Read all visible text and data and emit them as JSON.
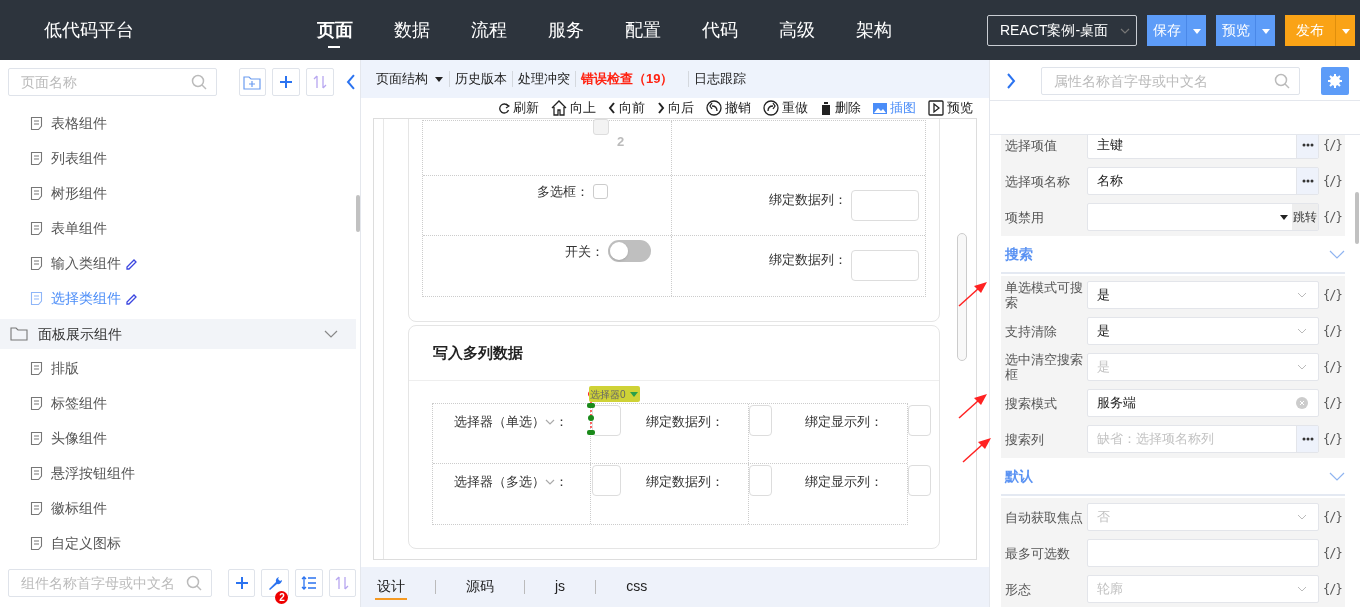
{
  "app_title": "低代码平台",
  "nav": [
    {
      "label": "页面",
      "selected": true
    },
    {
      "label": "数据",
      "selected": false
    },
    {
      "label": "流程",
      "selected": false
    },
    {
      "label": "服务",
      "selected": false
    },
    {
      "label": "配置",
      "selected": false
    },
    {
      "label": "代码",
      "selected": false
    },
    {
      "label": "高级",
      "selected": false
    },
    {
      "label": "架构",
      "selected": false
    }
  ],
  "project_select": "REACT案例-桌面",
  "actions": [
    {
      "label": "保存",
      "kind": "primary"
    },
    {
      "label": "预览",
      "kind": "primary"
    },
    {
      "label": "发布",
      "kind": "publish"
    }
  ],
  "left": {
    "search_placeholder": "页面名称",
    "tree": [
      {
        "kind": "page",
        "label": "表格组件",
        "selected": false,
        "edited": false
      },
      {
        "kind": "page",
        "label": "列表组件",
        "selected": false,
        "edited": false
      },
      {
        "kind": "page",
        "label": "树形组件",
        "selected": false,
        "edited": false
      },
      {
        "kind": "page",
        "label": "表单组件",
        "selected": false,
        "edited": false
      },
      {
        "kind": "page",
        "label": "输入类组件",
        "selected": false,
        "edited": true
      },
      {
        "kind": "page",
        "label": "选择类组件",
        "selected": true,
        "edited": true
      },
      {
        "kind": "folder",
        "label": "面板展示组件",
        "expanded": true,
        "children": [
          {
            "kind": "page",
            "label": "排版",
            "selected": false,
            "edited": false
          },
          {
            "kind": "page",
            "label": "标签组件",
            "selected": false,
            "edited": false
          },
          {
            "kind": "page",
            "label": "头像组件",
            "selected": false,
            "edited": false
          },
          {
            "kind": "page",
            "label": "悬浮按钮组件",
            "selected": false,
            "edited": false
          },
          {
            "kind": "page",
            "label": "徽标组件",
            "selected": false,
            "edited": false
          },
          {
            "kind": "page",
            "label": "自定义图标",
            "selected": false,
            "edited": false
          }
        ]
      }
    ],
    "bottom_search_placeholder": "组件名称首字母或中文名",
    "tool_badge": "2"
  },
  "editor": {
    "tabs": [
      {
        "label": "页面结构",
        "kind": "dropdown"
      },
      {
        "label": "历史版本",
        "kind": "plain"
      },
      {
        "label": "处理冲突",
        "kind": "plain"
      },
      {
        "label": "错误检查（19）",
        "kind": "error"
      },
      {
        "label": "日志跟踪",
        "kind": "plain"
      }
    ],
    "tools": [
      {
        "label": "刷新",
        "selected": false
      },
      {
        "label": "向上",
        "selected": false
      },
      {
        "label": "向前",
        "selected": false
      },
      {
        "label": "向后",
        "selected": false
      },
      {
        "label": "撤销",
        "selected": false
      },
      {
        "label": "重做",
        "selected": false
      },
      {
        "label": "删除",
        "selected": false
      },
      {
        "label": "插图",
        "selected": true
      },
      {
        "label": "预览",
        "selected": false
      }
    ],
    "top_form": {
      "rows": [
        {
          "cells": [
            {
              "kind": "option",
              "text": "2",
              "disabled": true
            },
            {
              "kind": "empty"
            }
          ]
        },
        {
          "cells": [
            {
              "kind": "checkbox",
              "label": "多选框：",
              "checked": false
            },
            {
              "kind": "input",
              "label": "绑定数据列："
            }
          ]
        },
        {
          "cells": [
            {
              "kind": "switch",
              "label": "开关：",
              "on": false
            },
            {
              "kind": "input",
              "label": "绑定数据列："
            }
          ]
        }
      ]
    },
    "section": {
      "title": "写入多列数据",
      "selection_tag": "选择器0",
      "rows": [
        {
          "cells": [
            {
              "kind": "select",
              "label": "选择器（单选）",
              "suffix": "：",
              "selected": true
            },
            {
              "kind": "input",
              "label": "绑定数据列："
            },
            {
              "kind": "input",
              "label": "绑定显示列："
            }
          ]
        },
        {
          "cells": [
            {
              "kind": "select",
              "label": "选择器（多选）",
              "suffix": "：",
              "selected": false
            },
            {
              "kind": "input",
              "label": "绑定数据列："
            },
            {
              "kind": "input",
              "label": "绑定显示列："
            }
          ]
        }
      ]
    },
    "bottom_tabs": [
      {
        "label": "设计",
        "selected": true
      },
      {
        "label": "源码",
        "selected": false
      },
      {
        "label": "js",
        "selected": false
      },
      {
        "label": "css",
        "selected": false
      }
    ]
  },
  "properties": {
    "search_placeholder": "属性名称首字母或中文名",
    "groups": [
      {
        "rows": [
          {
            "label": "选择项值",
            "kind": "text-more",
            "value": "主键",
            "code": "{/}"
          },
          {
            "label": "选择项名称",
            "kind": "text-more",
            "value": "名称",
            "code": "{/}"
          },
          {
            "label": "项禁用",
            "kind": "jump",
            "jump": "跳转",
            "code": "{/}"
          }
        ]
      },
      {
        "title": "搜索",
        "expanded": true,
        "rows": [
          {
            "label": "单选模式可搜索",
            "kind": "select",
            "value": "是",
            "code": "{/}"
          },
          {
            "label": "支持清除",
            "kind": "select",
            "value": "是",
            "code": "{/}"
          },
          {
            "label": "选中清空搜索框",
            "kind": "select",
            "placeholder": "是",
            "code": "{/}"
          },
          {
            "label": "搜索模式",
            "kind": "clearable",
            "value": "服务端",
            "code": "{/}"
          },
          {
            "label": "搜索列",
            "kind": "text-more",
            "placeholder": "缺省：选择项名称列",
            "code": "{/}"
          }
        ]
      },
      {
        "title": "默认",
        "expanded": true,
        "rows": [
          {
            "label": "自动获取焦点",
            "kind": "select",
            "placeholder": "否",
            "code": "{/}"
          },
          {
            "label": "最多可选数",
            "kind": "text",
            "code": "{/}"
          },
          {
            "label": "形态",
            "kind": "select",
            "placeholder": "轮廓",
            "code": "{/}"
          }
        ]
      }
    ]
  }
}
